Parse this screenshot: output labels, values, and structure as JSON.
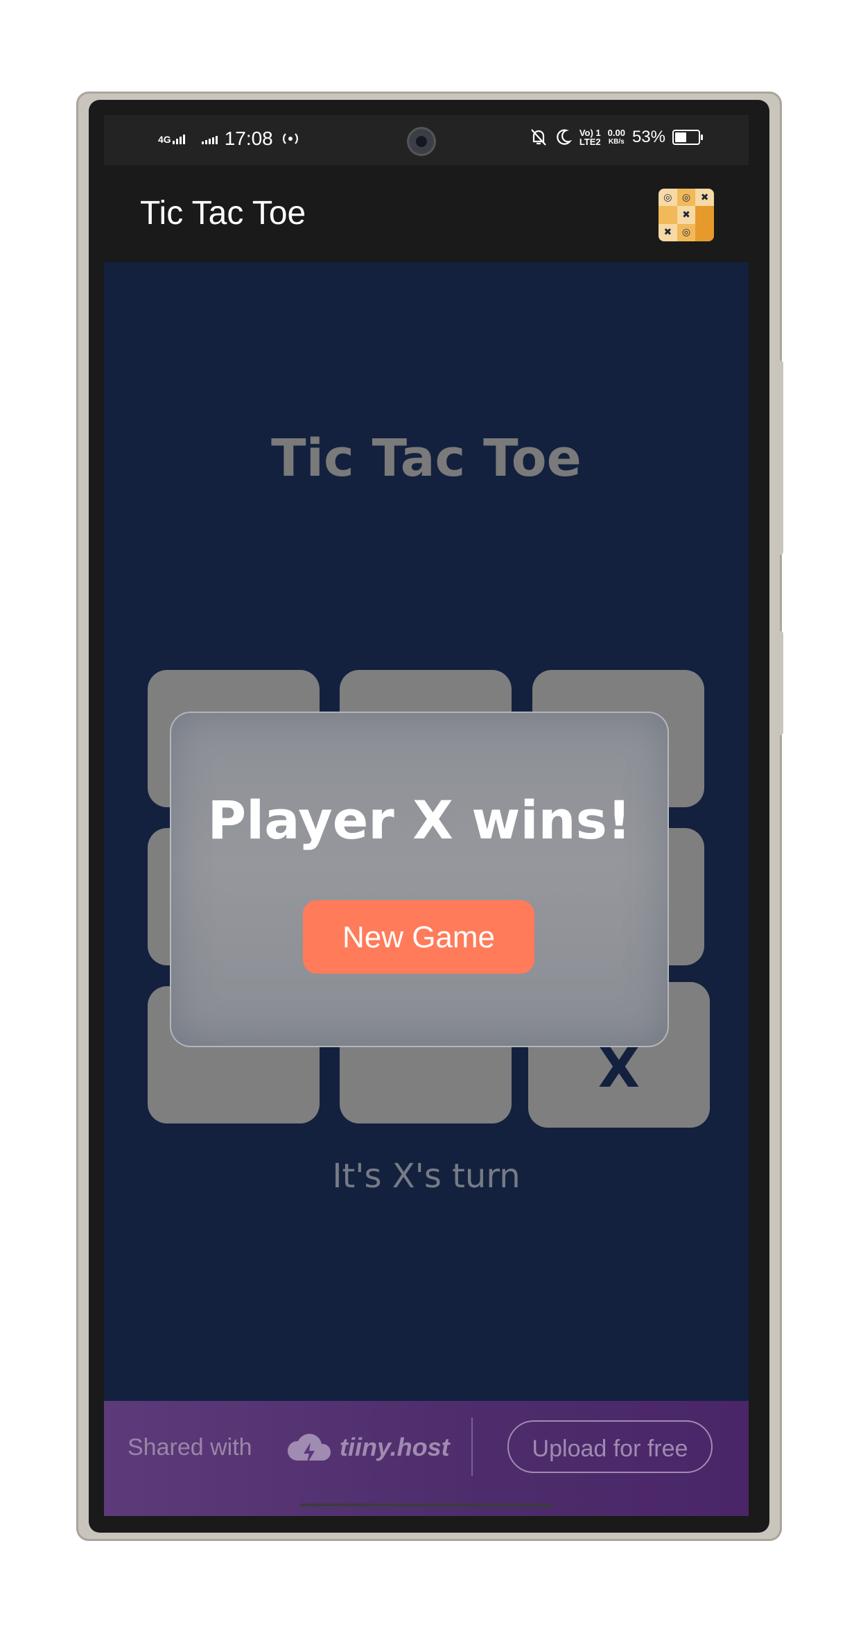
{
  "status_bar": {
    "network_type": "4G",
    "time": "17:08",
    "volte_label_top": "Vo) 1",
    "volte_label_bottom": "LTE2",
    "speed_value": "0.00",
    "speed_unit": "KB/s",
    "battery_percent": "53%",
    "battery_level": 0.53
  },
  "app_bar": {
    "title": "Tic Tac Toe",
    "icon": "tic-tac-toe-app-icon"
  },
  "game": {
    "title": "Tic Tac Toe",
    "board": [
      "",
      "",
      "",
      "",
      "",
      "",
      "",
      "",
      "X"
    ],
    "turn_text": "It's X's turn"
  },
  "modal": {
    "message": "Player X wins!",
    "button_label": "New Game"
  },
  "footer": {
    "shared_label": "Shared with",
    "brand": "tiiny.host",
    "upload_label": "Upload for free"
  },
  "colors": {
    "background": "#13213f",
    "accent": "#ff7b5a",
    "footer": "#4e2c6b"
  }
}
